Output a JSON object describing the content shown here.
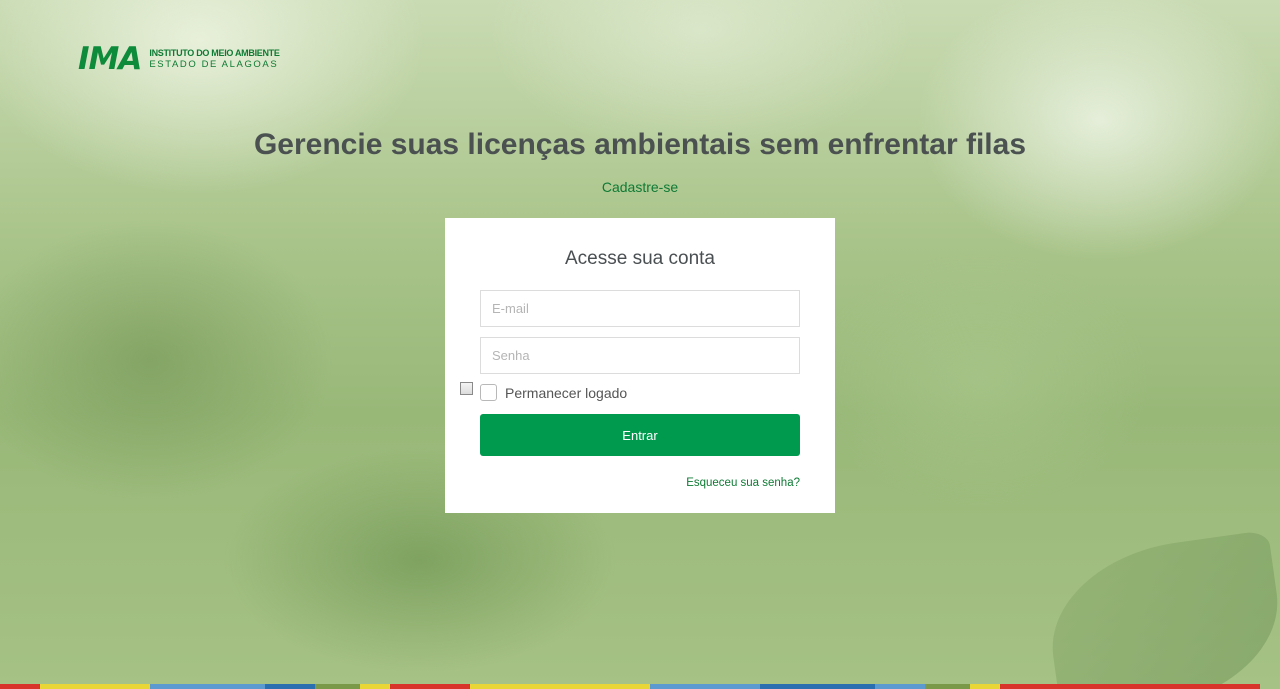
{
  "logo": {
    "mark": "IMA",
    "line1": "INSTITUTO DO MEIO AMBIENTE",
    "line2": "ESTADO DE ALAGOAS"
  },
  "headline": "Gerencie suas licenças ambientais sem enfrentar filas",
  "signup_link": "Cadastre-se",
  "login": {
    "title": "Acesse sua conta",
    "email_placeholder": "E-mail",
    "email_value": "",
    "password_placeholder": "Senha",
    "password_value": "",
    "remember_label": "Permanecer logado",
    "remember_checked": false,
    "submit_label": "Entrar",
    "forgot_label": "Esqueceu sua senha?"
  },
  "colors": {
    "brand_green": "#0e8a3b",
    "button_green": "#009a4e",
    "stripe": [
      "#d8342c",
      "#e8d636",
      "#5a9ad0",
      "#2a6fb0",
      "#7a9a4a",
      "#e8d636",
      "#d8342c",
      "#e8d636",
      "#5a9ad0",
      "#2a6fb0",
      "#5a9ad0",
      "#7a9a4a",
      "#e8d636",
      "#d8342c"
    ]
  }
}
